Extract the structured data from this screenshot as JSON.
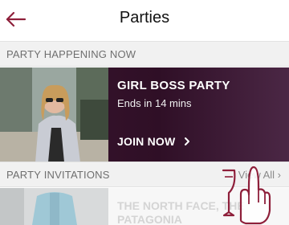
{
  "header": {
    "title": "Parties",
    "back_icon": "arrow-left-icon"
  },
  "sections": {
    "now": {
      "label": "PARTY HAPPENING NOW"
    },
    "invitations": {
      "label": "PARTY INVITATIONS",
      "view_all": "View All ›"
    }
  },
  "current_party": {
    "name": "GIRL BOSS PARTY",
    "subtitle": "Ends in 14 mins",
    "join_label": "JOIN NOW",
    "join_icon": "chevron-right-icon"
  },
  "invitation": {
    "line1": "THE NORTH FACE, THE",
    "line2": "PATAGONIA"
  },
  "colors": {
    "accent": "#8e1f3a",
    "card_bg": "#3a1630"
  }
}
